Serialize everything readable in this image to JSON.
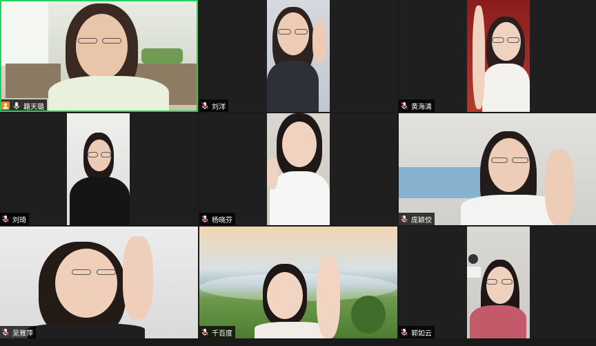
{
  "participants": [
    {
      "name": "籍天璐",
      "muted": false,
      "active_speaker": true
    },
    {
      "name": "刘洋",
      "muted": true,
      "active_speaker": false
    },
    {
      "name": "黄海清",
      "muted": true,
      "active_speaker": false
    },
    {
      "name": "刘琦",
      "muted": true,
      "active_speaker": false
    },
    {
      "name": "杨晓芬",
      "muted": true,
      "active_speaker": false
    },
    {
      "name": "庞颖佼",
      "muted": true,
      "active_speaker": false
    },
    {
      "name": "吴雅萍",
      "muted": true,
      "active_speaker": false
    },
    {
      "name": "千百度",
      "muted": true,
      "active_speaker": false
    },
    {
      "name": "郭如云",
      "muted": true,
      "active_speaker": false
    }
  ],
  "colors": {
    "active_border": "#23d160",
    "muted_mic": "#e0303a",
    "tile_bg": "#1f1f1f",
    "nameplate_bg": "#000000"
  },
  "icons": {
    "person": "person-icon",
    "mic": "mic-icon",
    "mic_muted": "mic-muted-icon"
  }
}
